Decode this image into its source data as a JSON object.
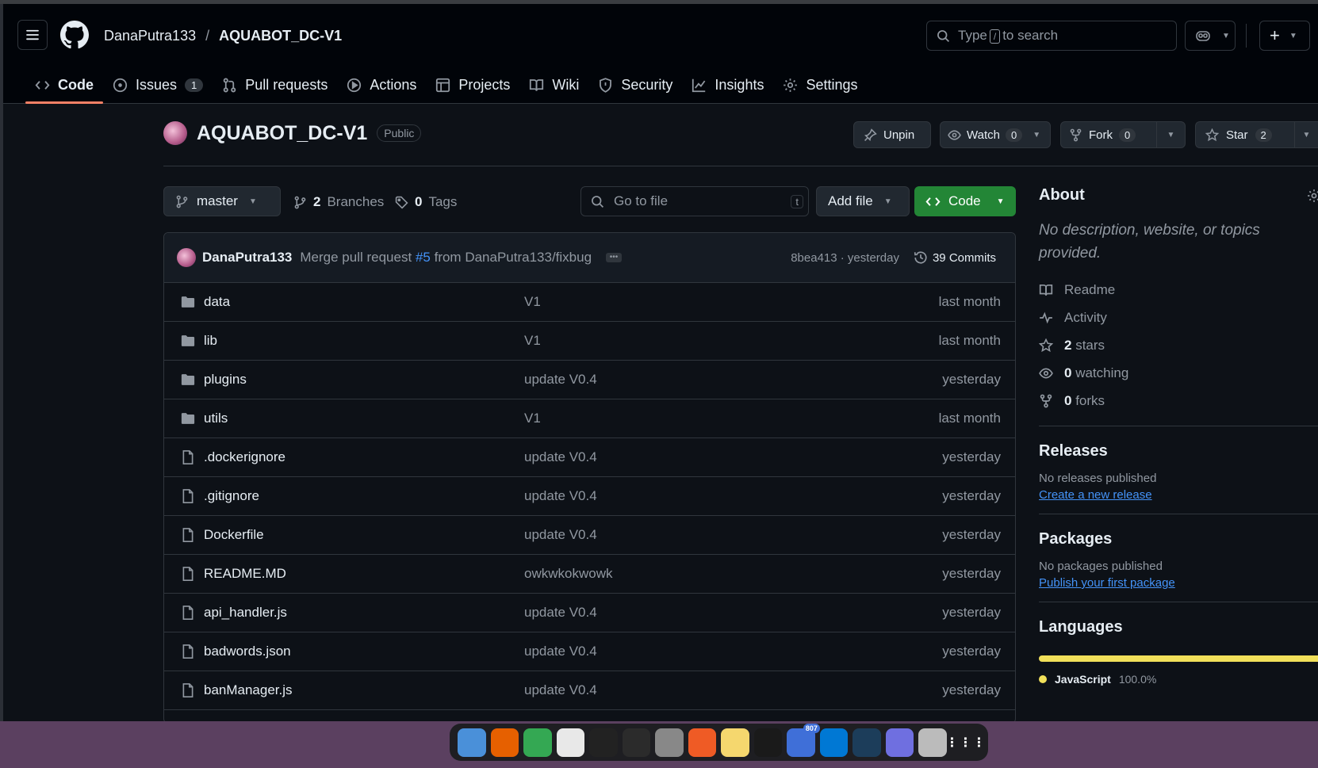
{
  "header": {
    "owner": "DanaPutra133",
    "separator": "/",
    "repo": "AQUABOT_DC-V1",
    "search_prefix": "Type",
    "search_key": "/",
    "search_suffix": "to search"
  },
  "tabs": [
    {
      "label": "Code",
      "icon": "code-icon"
    },
    {
      "label": "Issues",
      "icon": "issue-icon",
      "count": "1"
    },
    {
      "label": "Pull requests",
      "icon": "pull-request-icon"
    },
    {
      "label": "Actions",
      "icon": "play-icon"
    },
    {
      "label": "Projects",
      "icon": "table-icon"
    },
    {
      "label": "Wiki",
      "icon": "book-icon"
    },
    {
      "label": "Security",
      "icon": "shield-icon"
    },
    {
      "label": "Insights",
      "icon": "graph-icon"
    },
    {
      "label": "Settings",
      "icon": "gear-icon"
    }
  ],
  "repo_header": {
    "name": "AQUABOT_DC-V1",
    "visibility": "Public",
    "unpin": "Unpin",
    "watch": "Watch",
    "watch_count": "0",
    "fork": "Fork",
    "fork_count": "0",
    "star": "Star",
    "star_count": "2"
  },
  "toolbar": {
    "branch": "master",
    "branches_count": "2",
    "branches_label": "Branches",
    "tags_count": "0",
    "tags_label": "Tags",
    "goto_placeholder": "Go to file",
    "goto_key": "t",
    "add_file": "Add file",
    "code": "Code"
  },
  "commit": {
    "author": "DanaPutra133",
    "message_prefix": "Merge pull request",
    "pr": "#5",
    "message_suffix": "from DanaPutra133/fixbug",
    "sha_time": "8bea413 · yesterday",
    "commits": "39 Commits"
  },
  "files": [
    {
      "type": "dir",
      "name": "data",
      "message": "V1",
      "when": "last month"
    },
    {
      "type": "dir",
      "name": "lib",
      "message": "V1",
      "when": "last month"
    },
    {
      "type": "dir",
      "name": "plugins",
      "message": "update V0.4",
      "when": "yesterday"
    },
    {
      "type": "dir",
      "name": "utils",
      "message": "V1",
      "when": "last month"
    },
    {
      "type": "file",
      "name": ".dockerignore",
      "message": "update V0.4",
      "when": "yesterday"
    },
    {
      "type": "file",
      "name": ".gitignore",
      "message": "update V0.4",
      "when": "yesterday"
    },
    {
      "type": "file",
      "name": "Dockerfile",
      "message": "update V0.4",
      "when": "yesterday"
    },
    {
      "type": "file",
      "name": "README.MD",
      "message": "owkwkokwowk",
      "when": "yesterday"
    },
    {
      "type": "file",
      "name": "api_handler.js",
      "message": "update V0.4",
      "when": "yesterday"
    },
    {
      "type": "file",
      "name": "badwords.json",
      "message": "update V0.4",
      "when": "yesterday"
    },
    {
      "type": "file",
      "name": "banManager.js",
      "message": "update V0.4",
      "when": "yesterday"
    }
  ],
  "about": {
    "title": "About",
    "description": "No description, website, or topics provided.",
    "readme": "Readme",
    "activity": "Activity",
    "stars_count": "2",
    "stars_label": "stars",
    "watching_count": "0",
    "watching_label": "watching",
    "forks_count": "0",
    "forks_label": "forks"
  },
  "releases": {
    "title": "Releases",
    "empty": "No releases published",
    "link": "Create a new release"
  },
  "packages": {
    "title": "Packages",
    "empty": "No packages published",
    "link": "Publish your first package"
  },
  "languages": {
    "title": "Languages",
    "items": [
      {
        "name": "JavaScript",
        "percent": "100.0%",
        "color": "#f1e05a"
      }
    ]
  },
  "dock": {
    "apps": [
      {
        "name": "files",
        "color": "#4a90d9"
      },
      {
        "name": "firefox",
        "color": "#e66000"
      },
      {
        "name": "chrome",
        "color": "#34a853"
      },
      {
        "name": "text-editor",
        "color": "#e8e8e8"
      },
      {
        "name": "app-a",
        "color": "#222222"
      },
      {
        "name": "terminal",
        "color": "#2b2b2b"
      },
      {
        "name": "settings",
        "color": "#888888"
      },
      {
        "name": "postman",
        "color": "#ef5b25"
      },
      {
        "name": "notes",
        "color": "#f5d76e"
      },
      {
        "name": "webstorm",
        "color": "#1a1a1a"
      },
      {
        "name": "chat",
        "color": "#3f6fd8",
        "badge": "807"
      },
      {
        "name": "vscode",
        "color": "#0078d4"
      },
      {
        "name": "app-b",
        "color": "#1c3d5a"
      },
      {
        "name": "image-viewer",
        "color": "#6f6fe0"
      },
      {
        "name": "trash",
        "color": "#bbbbbb"
      },
      {
        "name": "app-grid",
        "color": "#1e1e22"
      }
    ]
  }
}
